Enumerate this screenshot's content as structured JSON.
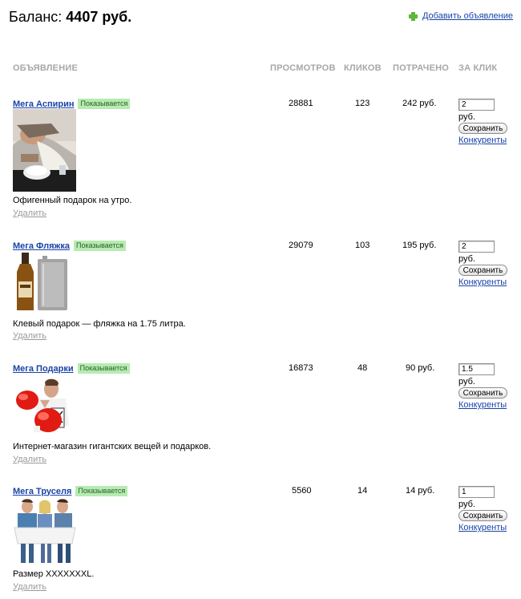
{
  "header": {
    "balance_label": "Баланс:",
    "balance_value": "4407 руб.",
    "add_ad": "Добавить объявление"
  },
  "columns": {
    "ad": "ОБЪЯВЛЕНИЕ",
    "views": "ПРОСМОТРОВ",
    "clicks": "КЛИКОВ",
    "spent": "ПОТРАЧЕНО",
    "per_click": "ЗА КЛИК"
  },
  "common": {
    "delete": "Удалить",
    "rub": "руб.",
    "save": "Сохранить",
    "competitors": "Конкуренты"
  },
  "ads": [
    {
      "title": "Мега Аспирин",
      "status": "Показывается",
      "views": "28881",
      "clicks": "123",
      "spent": "242 руб.",
      "bid": "2",
      "description": "Офигенный подарок на утро.",
      "image": "man-sleeping-with-gift-photo"
    },
    {
      "title": "Мега Фляжка",
      "status": "Показывается",
      "views": "29079",
      "clicks": "103",
      "spent": "195 руб.",
      "bid": "2",
      "description": "Клевый подарок — фляжка на 1.75 литра.",
      "image": "whisky-bottle-and-flask-photo"
    },
    {
      "title": "Мега Подарки",
      "status": "Показывается",
      "views": "16873",
      "clicks": "48",
      "spent": "90 руб.",
      "bid": "1.5",
      "description": "Интернет-магазин гигантских вещей и подарков.",
      "image": "man-with-boxing-gloves-photo"
    },
    {
      "title": "Мега Труселя",
      "status": "Показывается",
      "views": "5560",
      "clicks": "14",
      "spent": "14 руб.",
      "bid": "1",
      "description": "Размер XXXXXXXL.",
      "image": "three-people-in-giant-shorts-photo"
    }
  ]
}
